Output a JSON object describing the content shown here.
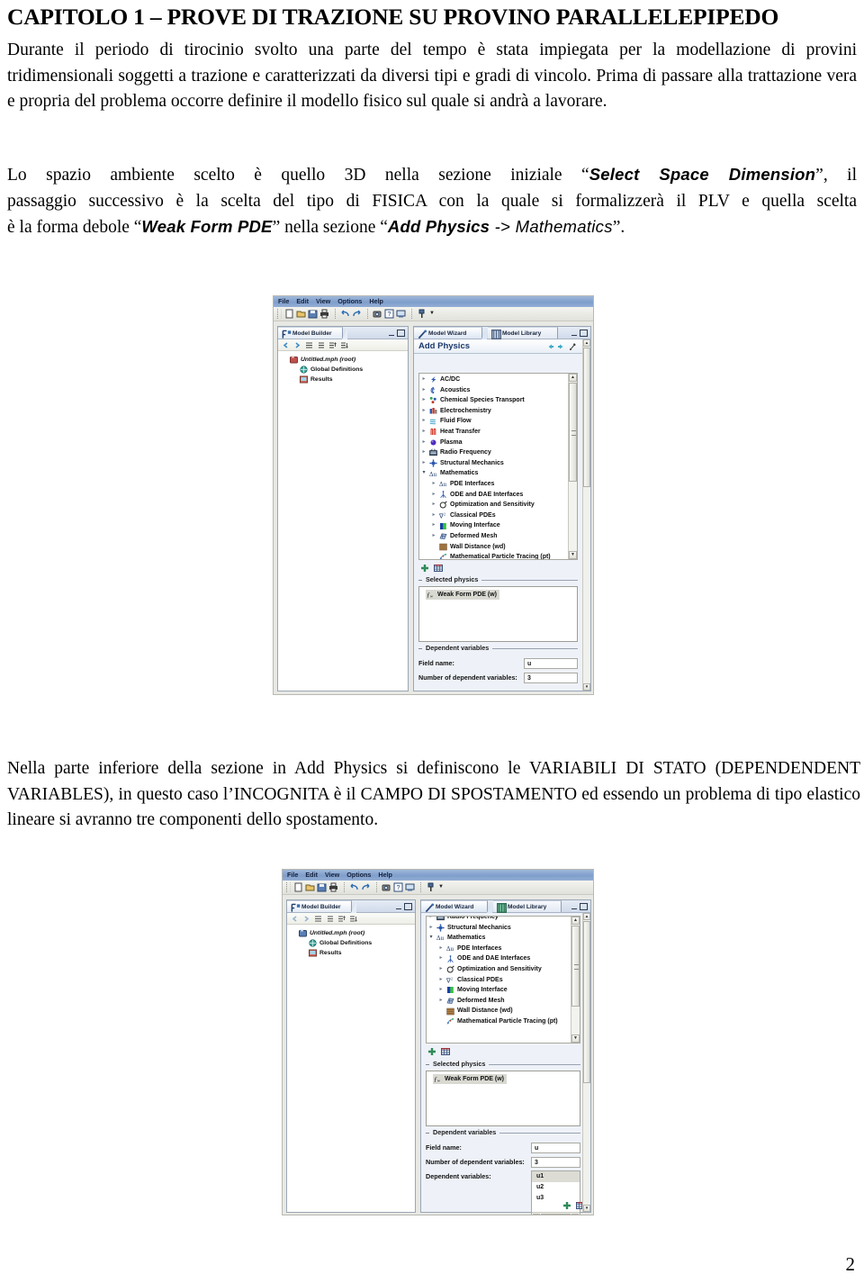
{
  "document": {
    "chapter_title": "CAPITOLO 1 – PROVE DI TRAZIONE SU PROVINO PARALLELEPIPEDO",
    "paragraph_1": "Durante il periodo di tirocinio svolto una parte del tempo è stata impiegata per la modellazione di provini tridimensionali soggetti a trazione e caratterizzati da diversi tipi e gradi di vincolo. Prima di passare alla trattazione vera e propria del problema occorre definire il modello fisico sul quale si andrà a lavorare.",
    "paragraph_2": {
      "line1_pre": "Lo spazio ambiente scelto è quello 3D nella sezione iniziale “",
      "line1_bold": "Select Space Dimension",
      "line1_post": "”, il",
      "line2": "passaggio successivo è la scelta del tipo di FISICA con la quale si formalizzerà il PLV e quella scelta",
      "line3_pre": "è la forma debole “",
      "line3_bold1": "Weak Form PDE",
      "line3_mid": "” nella sezione “",
      "line3_bold2": "Add Physics",
      "line3_arrow": " -> ",
      "line3_bold3": "Mathematics",
      "line3_post": "”."
    },
    "paragraph_3": "Nella parte inferiore della sezione in Add Physics si definiscono le VARIABILI DI STATO (DEPENDENDENT VARIABLES), in questo caso l’INCOGNITA è il CAMPO DI SPOSTAMENTO ed essendo un problema di tipo elastico lineare si avranno tre componenti dello spostamento.",
    "page_number": "2"
  },
  "screenshot1": {
    "menubar": [
      "File",
      "Edit",
      "View",
      "Options",
      "Help"
    ],
    "toolbar_icons": [
      "new-file-icon",
      "open-folder-icon",
      "save-icon",
      "print-icon",
      "undo-icon",
      "redo-icon",
      "camera-icon",
      "help-icon",
      "desktop-icon",
      "build-icon",
      "dropdown-caret-icon"
    ],
    "model_builder": {
      "tab_label": "Model Builder",
      "tab_icon": "model-builder-icon",
      "toolbar_icons": [
        "back-arrow-icon",
        "forward-arrow-icon",
        "collapse-icon",
        "expand-icon",
        "move-up-icon",
        "move-down-icon"
      ],
      "tree": [
        {
          "label": "Untitled.mph (root)",
          "icon": "root-node-icon",
          "indent": 0
        },
        {
          "label": "Global Definitions",
          "icon": "globe-icon",
          "indent": 1
        },
        {
          "label": "Results",
          "icon": "results-icon",
          "indent": 1
        }
      ]
    },
    "model_wizard": {
      "tabs": [
        {
          "label": "Model Wizard",
          "icon": "wizard-icon",
          "active": true
        },
        {
          "label": "Model Library",
          "icon": "library-icon",
          "active": false
        }
      ],
      "header_title": "Add Physics",
      "header_buttons": [
        "back-arrow-icon",
        "forward-arrow-icon",
        "finish-icon"
      ],
      "physics_tree": [
        {
          "label": "AC/DC",
          "icon": "acdc-icon",
          "indent": 0,
          "state": "collapsed"
        },
        {
          "label": "Acoustics",
          "icon": "acoustics-icon",
          "indent": 0,
          "state": "collapsed"
        },
        {
          "label": "Chemical Species Transport",
          "icon": "chemical-icon",
          "indent": 0,
          "state": "collapsed"
        },
        {
          "label": "Electrochemistry",
          "icon": "electrochemistry-icon",
          "indent": 0,
          "state": "collapsed"
        },
        {
          "label": "Fluid Flow",
          "icon": "fluidflow-icon",
          "indent": 0,
          "state": "collapsed"
        },
        {
          "label": "Heat Transfer",
          "icon": "heattransfer-icon",
          "indent": 0,
          "state": "collapsed"
        },
        {
          "label": "Plasma",
          "icon": "plasma-icon",
          "indent": 0,
          "state": "collapsed"
        },
        {
          "label": "Radio Frequency",
          "icon": "radiofrequency-icon",
          "indent": 0,
          "state": "collapsed"
        },
        {
          "label": "Structural Mechanics",
          "icon": "structural-icon",
          "indent": 0,
          "state": "collapsed"
        },
        {
          "label": "Mathematics",
          "icon": "mathematics-icon",
          "indent": 0,
          "state": "expanded"
        },
        {
          "label": "PDE Interfaces",
          "icon": "pde-icon",
          "indent": 1,
          "state": "collapsed"
        },
        {
          "label": "ODE and DAE Interfaces",
          "icon": "ode-icon",
          "indent": 1,
          "state": "collapsed"
        },
        {
          "label": "Optimization and Sensitivity",
          "icon": "optimization-icon",
          "indent": 1,
          "state": "collapsed"
        },
        {
          "label": "Classical PDEs",
          "icon": "classicalpde-icon",
          "indent": 1,
          "state": "collapsed"
        },
        {
          "label": "Moving Interface",
          "icon": "movinginterface-icon",
          "indent": 1,
          "state": "collapsed"
        },
        {
          "label": "Deformed Mesh",
          "icon": "deformedmesh-icon",
          "indent": 1,
          "state": "collapsed"
        },
        {
          "label": "Wall Distance (wd)",
          "icon": "walldistance-icon",
          "indent": 1,
          "state": "leaf"
        },
        {
          "label": "Mathematical Particle Tracing (pt)",
          "icon": "particletracing-icon",
          "indent": 1,
          "state": "leaf"
        }
      ],
      "action_icons": [
        "add-plus-icon",
        "remove-table-icon"
      ],
      "selected_physics": {
        "group_label": "Selected physics",
        "items": [
          {
            "label": "Weak Form PDE (w)",
            "icon": "fw-function-icon"
          }
        ]
      },
      "dependent_variables": {
        "group_label": "Dependent variables",
        "field_name_label": "Field name:",
        "field_name_value": "u",
        "count_label": "Number of dependent variables:",
        "count_value": "3"
      }
    }
  },
  "screenshot2": {
    "menubar": [
      "File",
      "Edit",
      "View",
      "Options",
      "Help"
    ],
    "toolbar_icons": [
      "new-file-icon",
      "open-folder-icon",
      "save-icon",
      "print-icon",
      "undo-icon",
      "redo-icon",
      "camera-icon",
      "help-icon",
      "desktop-icon",
      "build-icon",
      "dropdown-caret-icon"
    ],
    "model_builder": {
      "tab_label": "Model Builder",
      "tab_icon": "model-builder-icon",
      "toolbar_icons": [
        "back-arrow-icon",
        "forward-arrow-icon",
        "collapse-icon",
        "expand-icon",
        "move-up-icon",
        "move-down-icon"
      ],
      "tree": [
        {
          "label": "Untitled.mph (root)",
          "icon": "root-node-icon",
          "indent": 0
        },
        {
          "label": "Global Definitions",
          "icon": "globe-icon",
          "indent": 1
        },
        {
          "label": "Results",
          "icon": "results-icon",
          "indent": 1
        }
      ]
    },
    "model_wizard": {
      "tabs": [
        {
          "label": "Model Wizard",
          "icon": "wizard-icon",
          "active": true
        },
        {
          "label": "Model Library",
          "icon": "library-icon",
          "active": false
        }
      ],
      "physics_tree": [
        {
          "label": "Radio Frequency",
          "icon": "radiofrequency-icon",
          "indent": 0,
          "state": "collapsed"
        },
        {
          "label": "Structural Mechanics",
          "icon": "structural-icon",
          "indent": 0,
          "state": "collapsed"
        },
        {
          "label": "Mathematics",
          "icon": "mathematics-icon",
          "indent": 0,
          "state": "expanded"
        },
        {
          "label": "PDE Interfaces",
          "icon": "pde-icon",
          "indent": 1,
          "state": "collapsed"
        },
        {
          "label": "ODE and DAE Interfaces",
          "icon": "ode-icon",
          "indent": 1,
          "state": "collapsed"
        },
        {
          "label": "Optimization and Sensitivity",
          "icon": "optimization-icon",
          "indent": 1,
          "state": "collapsed"
        },
        {
          "label": "Classical PDEs",
          "icon": "classicalpde-icon",
          "indent": 1,
          "state": "collapsed"
        },
        {
          "label": "Moving Interface",
          "icon": "movinginterface-icon",
          "indent": 1,
          "state": "collapsed"
        },
        {
          "label": "Deformed Mesh",
          "icon": "deformedmesh-icon",
          "indent": 1,
          "state": "collapsed"
        },
        {
          "label": "Wall Distance (wd)",
          "icon": "walldistance-icon",
          "indent": 1,
          "state": "leaf"
        },
        {
          "label": "Mathematical Particle Tracing (pt)",
          "icon": "particletracing-icon",
          "indent": 1,
          "state": "leaf"
        }
      ],
      "action_icons": [
        "add-plus-icon",
        "remove-table-icon"
      ],
      "selected_physics": {
        "group_label": "Selected physics",
        "items": [
          {
            "label": "Weak Form PDE (w)",
            "icon": "fw-function-icon"
          }
        ]
      },
      "dependent_variables": {
        "group_label": "Dependent variables",
        "field_name_label": "Field name:",
        "field_name_value": "u",
        "count_label": "Number of dependent variables:",
        "count_value": "3",
        "list_label": "Dependent variables:",
        "variables": [
          "u1",
          "u2",
          "u3"
        ]
      },
      "bottom_action_icons": [
        "add-plus-icon",
        "remove-table-icon"
      ]
    }
  },
  "colors": {
    "menubar_blue": "#7f9ecb",
    "panel_border": "#9aa7b5",
    "title_blue": "#1a3869",
    "window_bg": "#e8e8e4"
  }
}
